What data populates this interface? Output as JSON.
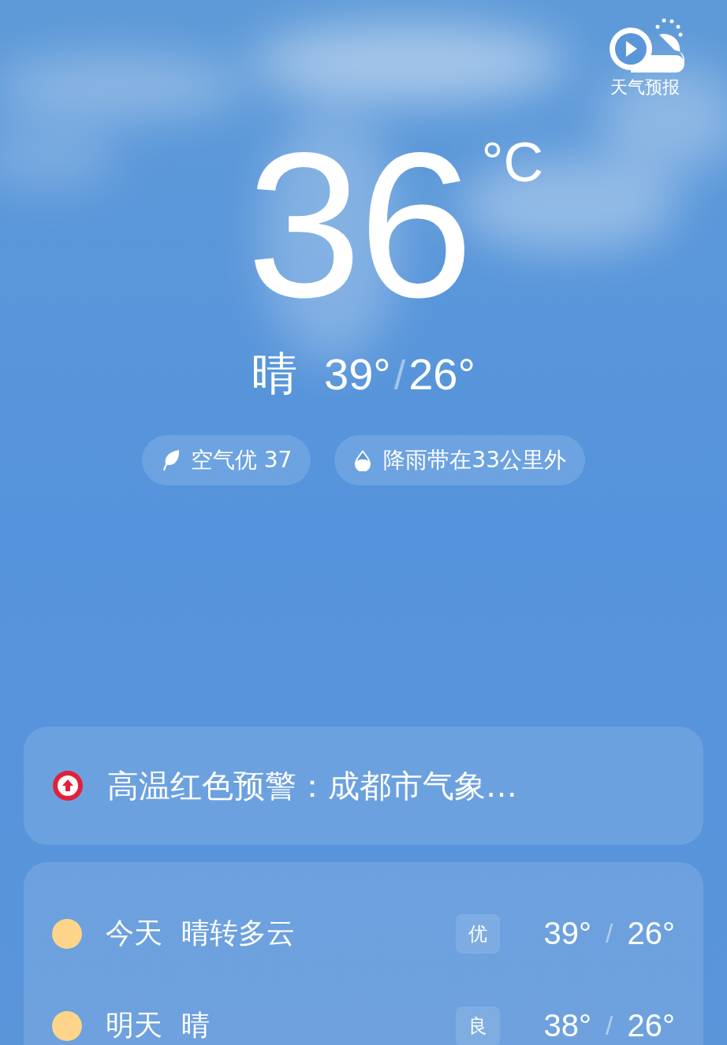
{
  "app_badge": {
    "label": "天气预报"
  },
  "current": {
    "temperature": "36",
    "unit": "°C",
    "condition": "晴",
    "high": "39°",
    "separator": "/",
    "low": "26°"
  },
  "chips": [
    {
      "kind": "air",
      "text": "空气优 37"
    },
    {
      "kind": "rain",
      "text": "降雨带在33公里外"
    }
  ],
  "alert": {
    "text": "高温红色预警：成都市气象…"
  },
  "forecast": [
    {
      "day": "今天",
      "condition": "晴转多云",
      "aqi": "优",
      "high": "39°",
      "separator": "/",
      "low": "26°"
    },
    {
      "day": "明天",
      "condition": "晴",
      "aqi": "良",
      "high": "38°",
      "separator": "/",
      "low": "26°"
    }
  ]
}
